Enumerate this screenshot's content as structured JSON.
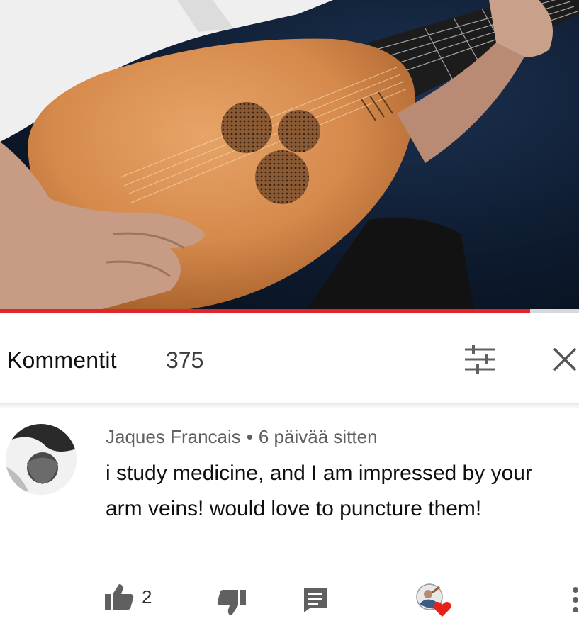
{
  "video": {
    "progress_percent": 91.5,
    "accent": "#e0252d"
  },
  "header": {
    "title": "Kommentit",
    "count": "375",
    "icons": {
      "sort": "sort-sliders-icon",
      "close": "close-icon"
    }
  },
  "comment": {
    "author": "Jaques Francais",
    "separator": "•",
    "timestamp": "6 päivää sitten",
    "text": "i study medicine, and I am impressed by your arm veins! would love to puncture them!",
    "likes": "2",
    "icons": {
      "like": "thumbs-up-icon",
      "dislike": "thumbs-down-icon",
      "reply": "reply-icon",
      "creator_heart": "creator-heart-icon",
      "more": "more-vertical-icon"
    },
    "heart_color": "#e62117"
  }
}
